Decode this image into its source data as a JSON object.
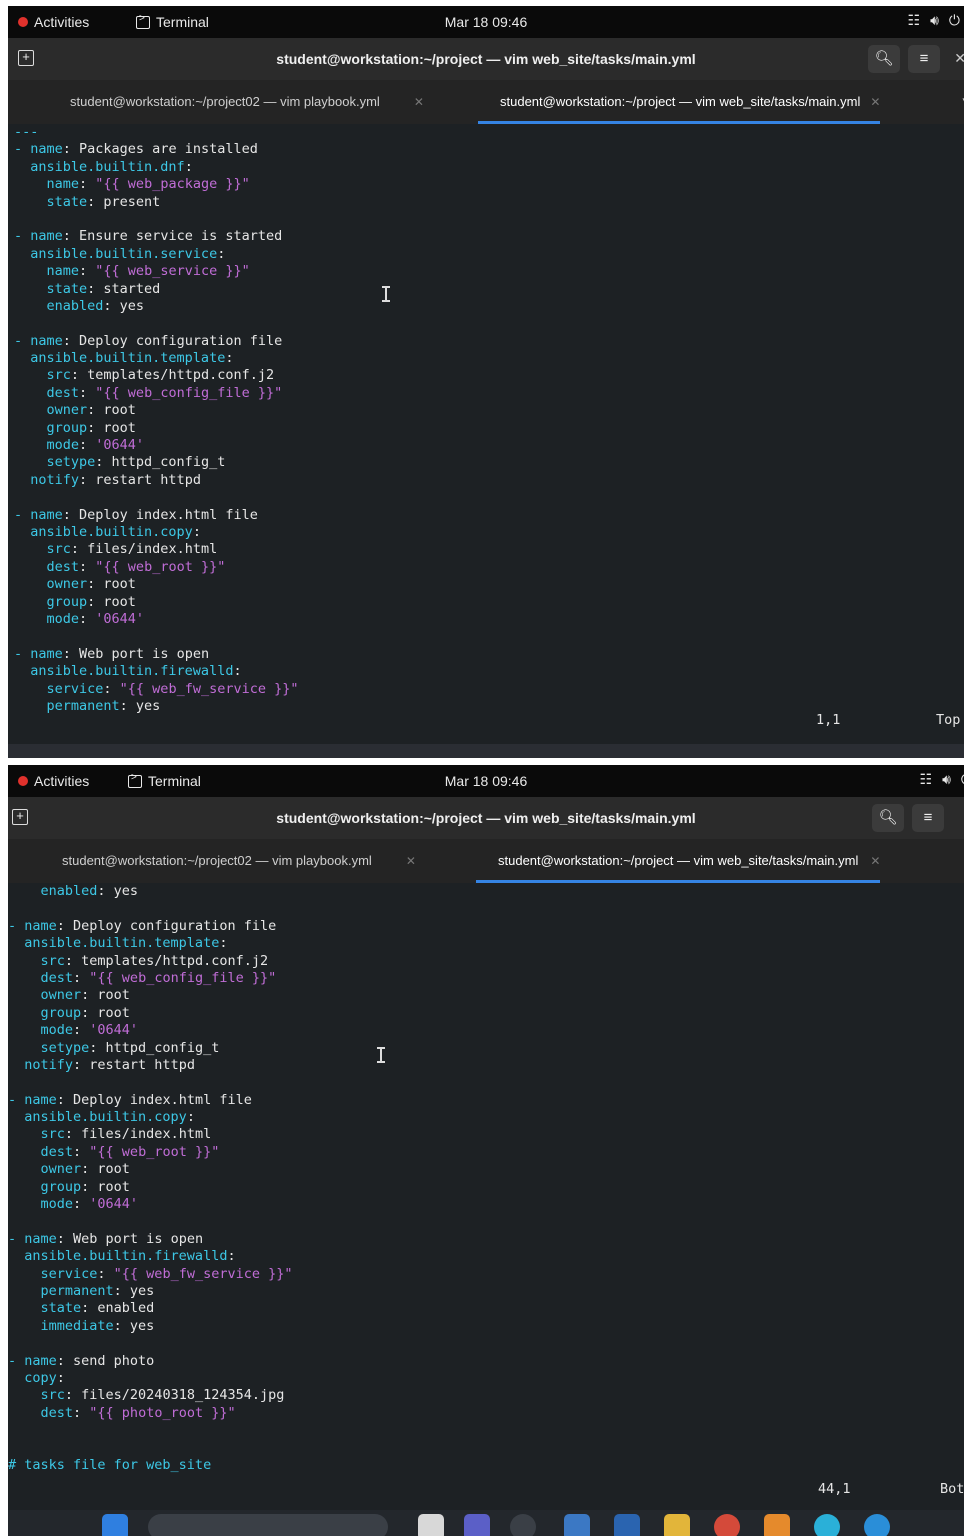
{
  "topbar": {
    "activities": "Activities",
    "app": "Terminal",
    "clock": "Mar 18 09:46"
  },
  "window": {
    "title": "student@workstation:~/project — vim web_site/tasks/main.yml",
    "tabs": [
      {
        "label": "student@workstation:~/project02 — vim playbook.yml",
        "active": false
      },
      {
        "label": "student@workstation:~/project — vim web_site/tasks/main.yml",
        "active": true
      }
    ]
  },
  "top_screen": {
    "lines": [
      [
        [
          "c",
          "---"
        ]
      ],
      [
        [
          "k",
          "- name"
        ],
        [
          "t",
          ": Packages are installed"
        ]
      ],
      [
        [
          "k",
          "  ansible.builtin.dnf"
        ],
        [
          "t",
          ":"
        ]
      ],
      [
        [
          "k",
          "    name"
        ],
        [
          "t",
          ": "
        ],
        [
          "s",
          "\"{{ web_package }}\""
        ]
      ],
      [
        [
          "k",
          "    state"
        ],
        [
          "t",
          ": present"
        ]
      ],
      [
        [
          "t",
          ""
        ]
      ],
      [
        [
          "k",
          "- name"
        ],
        [
          "t",
          ": Ensure service is started"
        ]
      ],
      [
        [
          "k",
          "  ansible.builtin.service"
        ],
        [
          "t",
          ":"
        ]
      ],
      [
        [
          "k",
          "    name"
        ],
        [
          "t",
          ": "
        ],
        [
          "s",
          "\"{{ web_service }}\""
        ]
      ],
      [
        [
          "k",
          "    state"
        ],
        [
          "t",
          ": started"
        ]
      ],
      [
        [
          "k",
          "    enabled"
        ],
        [
          "t",
          ": yes"
        ]
      ],
      [
        [
          "t",
          ""
        ]
      ],
      [
        [
          "k",
          "- name"
        ],
        [
          "t",
          ": Deploy configuration file"
        ]
      ],
      [
        [
          "k",
          "  ansible.builtin.template"
        ],
        [
          "t",
          ":"
        ]
      ],
      [
        [
          "k",
          "    src"
        ],
        [
          "t",
          ": templates/httpd.conf.j2"
        ]
      ],
      [
        [
          "k",
          "    dest"
        ],
        [
          "t",
          ": "
        ],
        [
          "s",
          "\"{{ web_config_file }}\""
        ]
      ],
      [
        [
          "k",
          "    owner"
        ],
        [
          "t",
          ": root"
        ]
      ],
      [
        [
          "k",
          "    group"
        ],
        [
          "t",
          ": root"
        ]
      ],
      [
        [
          "k",
          "    mode"
        ],
        [
          "t",
          ": "
        ],
        [
          "s",
          "'0644'"
        ]
      ],
      [
        [
          "k",
          "    setype"
        ],
        [
          "t",
          ": httpd_config_t"
        ]
      ],
      [
        [
          "k",
          "  notify"
        ],
        [
          "t",
          ": restart httpd"
        ]
      ],
      [
        [
          "t",
          ""
        ]
      ],
      [
        [
          "k",
          "- name"
        ],
        [
          "t",
          ": Deploy index.html file"
        ]
      ],
      [
        [
          "k",
          "  ansible.builtin.copy"
        ],
        [
          "t",
          ":"
        ]
      ],
      [
        [
          "k",
          "    src"
        ],
        [
          "t",
          ": files/index.html"
        ]
      ],
      [
        [
          "k",
          "    dest"
        ],
        [
          "t",
          ": "
        ],
        [
          "s",
          "\"{{ web_root }}\""
        ]
      ],
      [
        [
          "k",
          "    owner"
        ],
        [
          "t",
          ": root"
        ]
      ],
      [
        [
          "k",
          "    group"
        ],
        [
          "t",
          ": root"
        ]
      ],
      [
        [
          "k",
          "    mode"
        ],
        [
          "t",
          ": "
        ],
        [
          "s",
          "'0644'"
        ]
      ],
      [
        [
          "t",
          ""
        ]
      ],
      [
        [
          "k",
          "- name"
        ],
        [
          "t",
          ": Web port is open"
        ]
      ],
      [
        [
          "k",
          "  ansible.builtin.firewalld"
        ],
        [
          "t",
          ":"
        ]
      ],
      [
        [
          "k",
          "    service"
        ],
        [
          "t",
          ": "
        ],
        [
          "s",
          "\"{{ web_fw_service }}\""
        ]
      ],
      [
        [
          "k",
          "    permanent"
        ],
        [
          "t",
          ": yes"
        ]
      ]
    ],
    "status_pos": "1,1",
    "status_where": "Top"
  },
  "bottom_screen": {
    "lines": [
      [
        [
          "k",
          "    enabled"
        ],
        [
          "t",
          ": yes"
        ]
      ],
      [
        [
          "t",
          ""
        ]
      ],
      [
        [
          "k",
          "- name"
        ],
        [
          "t",
          ": Deploy configuration file"
        ]
      ],
      [
        [
          "k",
          "  ansible.builtin.template"
        ],
        [
          "t",
          ":"
        ]
      ],
      [
        [
          "k",
          "    src"
        ],
        [
          "t",
          ": templates/httpd.conf.j2"
        ]
      ],
      [
        [
          "k",
          "    dest"
        ],
        [
          "t",
          ": "
        ],
        [
          "s",
          "\"{{ web_config_file }}\""
        ]
      ],
      [
        [
          "k",
          "    owner"
        ],
        [
          "t",
          ": root"
        ]
      ],
      [
        [
          "k",
          "    group"
        ],
        [
          "t",
          ": root"
        ]
      ],
      [
        [
          "k",
          "    mode"
        ],
        [
          "t",
          ": "
        ],
        [
          "s",
          "'0644'"
        ]
      ],
      [
        [
          "k",
          "    setype"
        ],
        [
          "t",
          ": httpd_config_t"
        ]
      ],
      [
        [
          "k",
          "  notify"
        ],
        [
          "t",
          ": restart httpd"
        ]
      ],
      [
        [
          "t",
          ""
        ]
      ],
      [
        [
          "k",
          "- name"
        ],
        [
          "t",
          ": Deploy index.html file"
        ]
      ],
      [
        [
          "k",
          "  ansible.builtin.copy"
        ],
        [
          "t",
          ":"
        ]
      ],
      [
        [
          "k",
          "    src"
        ],
        [
          "t",
          ": files/index.html"
        ]
      ],
      [
        [
          "k",
          "    dest"
        ],
        [
          "t",
          ": "
        ],
        [
          "s",
          "\"{{ web_root }}\""
        ]
      ],
      [
        [
          "k",
          "    owner"
        ],
        [
          "t",
          ": root"
        ]
      ],
      [
        [
          "k",
          "    group"
        ],
        [
          "t",
          ": root"
        ]
      ],
      [
        [
          "k",
          "    mode"
        ],
        [
          "t",
          ": "
        ],
        [
          "s",
          "'0644'"
        ]
      ],
      [
        [
          "t",
          ""
        ]
      ],
      [
        [
          "k",
          "- name"
        ],
        [
          "t",
          ": Web port is open"
        ]
      ],
      [
        [
          "k",
          "  ansible.builtin.firewalld"
        ],
        [
          "t",
          ":"
        ]
      ],
      [
        [
          "k",
          "    service"
        ],
        [
          "t",
          ": "
        ],
        [
          "s",
          "\"{{ web_fw_service }}\""
        ]
      ],
      [
        [
          "k",
          "    permanent"
        ],
        [
          "t",
          ": yes"
        ]
      ],
      [
        [
          "k",
          "    state"
        ],
        [
          "t",
          ": enabled"
        ]
      ],
      [
        [
          "k",
          "    immediate"
        ],
        [
          "t",
          ": yes"
        ]
      ],
      [
        [
          "t",
          ""
        ]
      ],
      [
        [
          "k",
          "- name"
        ],
        [
          "t",
          ": send photo"
        ]
      ],
      [
        [
          "k",
          "  copy"
        ],
        [
          "t",
          ":"
        ]
      ],
      [
        [
          "k",
          "    src"
        ],
        [
          "t",
          ": files/20240318_124354.jpg"
        ]
      ],
      [
        [
          "k",
          "    dest"
        ],
        [
          "t",
          ": "
        ],
        [
          "s",
          "\"{{ photo_root }}\""
        ]
      ],
      [
        [
          "t",
          ""
        ]
      ],
      [
        [
          "t",
          ""
        ]
      ],
      [
        [
          "c",
          "# tasks file for web_site"
        ]
      ]
    ],
    "status_pos": "44,1",
    "status_where": "Bot"
  },
  "colors": {
    "terminal_bg": "#1d2124",
    "key": "#3dc8e6",
    "string": "#c06dd6",
    "accent": "#3584e4"
  },
  "icons": [
    "power-icon",
    "network-icon",
    "volume-icon",
    "search-icon",
    "menu-icon",
    "new-tab-icon",
    "terminal-icon"
  ]
}
